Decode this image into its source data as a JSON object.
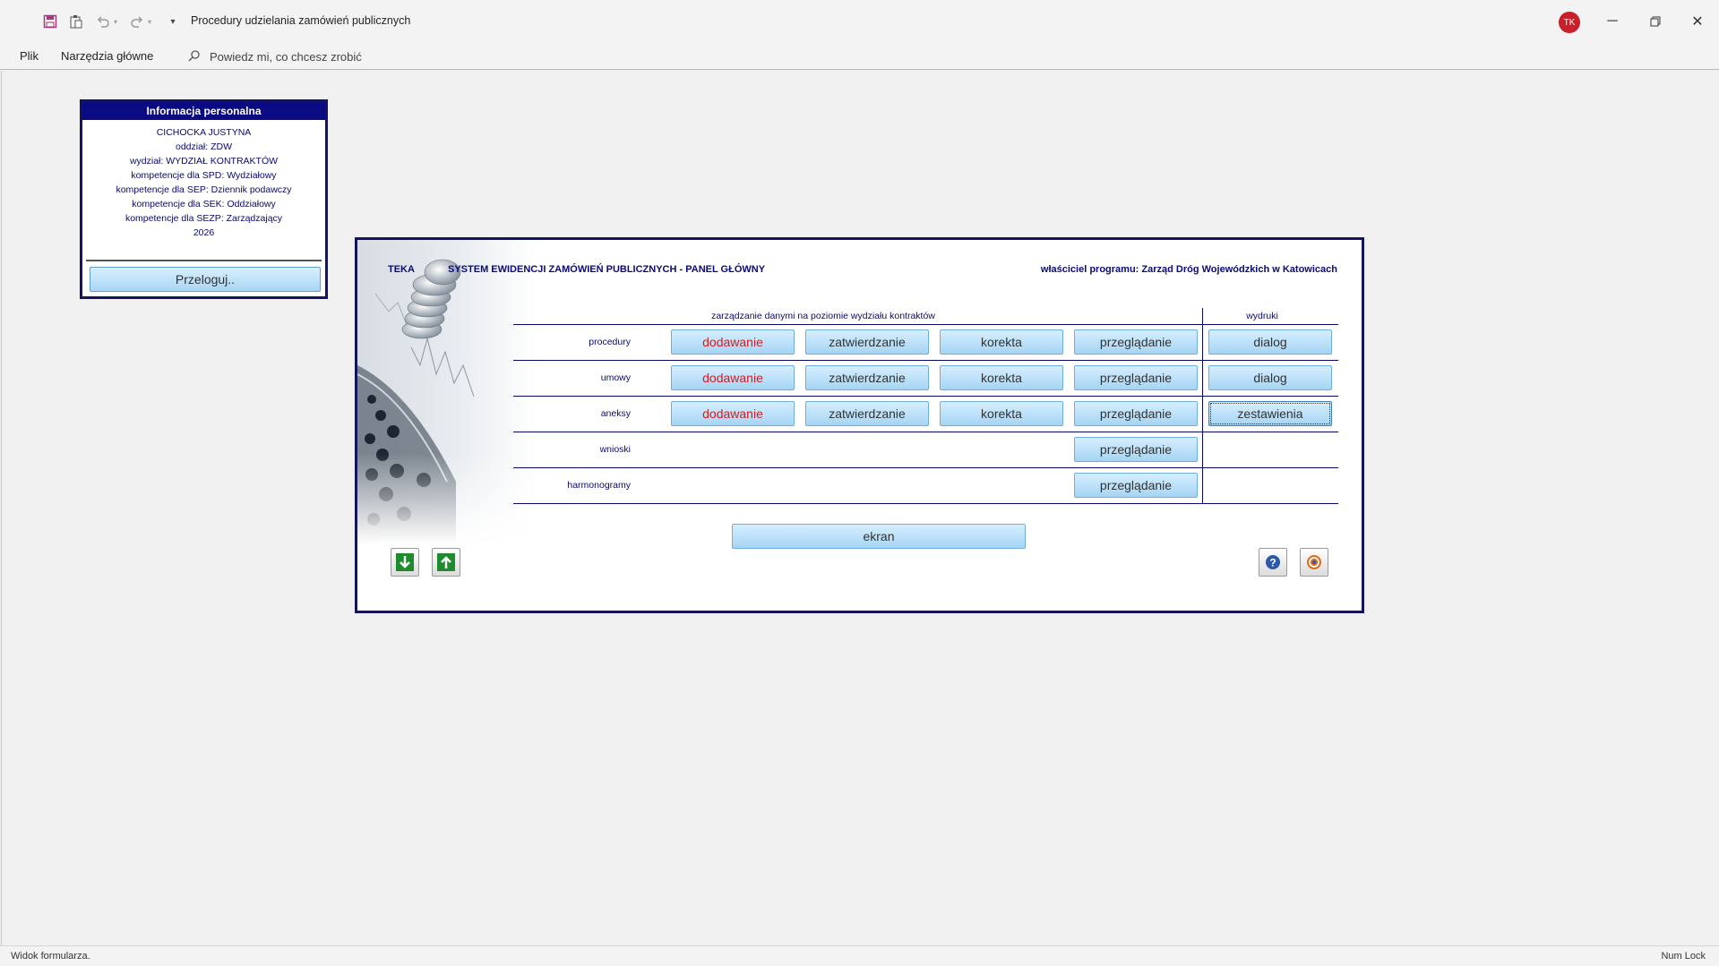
{
  "window": {
    "title": "Procedury udzielania zamówień publicznych",
    "user_initials": "TK"
  },
  "menu": {
    "file": "Plik",
    "home": "Narzędzia główne",
    "tell_me": "Powiedz mi, co chcesz zrobić"
  },
  "info_panel": {
    "title": "Informacja personalna",
    "lines": [
      "CICHOCKA JUSTYNA",
      "oddział: ZDW",
      "wydział: WYDZIAŁ KONTRAKTÓW",
      "kompetencje dla SPD: Wydziałowy",
      "kompetencje dla SEP: Dziennik podawczy",
      "kompetencje dla SEK: Oddziałowy",
      "kompetencje dla SEZP: Zarządzający",
      "2026"
    ],
    "logout_label": "Przeloguj.."
  },
  "main_panel": {
    "app_name": "TEKA",
    "system_title": "SYSTEM EWIDENCJI ZAMÓWIEŃ PUBLICZNYCH - PANEL GŁÓWNY",
    "owner": "właściciel programu: Zarząd Dróg Wojewódzkich w Katowicach",
    "header_management": "zarządzanie danymi na poziomie wydziału kontraktów",
    "header_printouts": "wydruki",
    "rows": [
      {
        "label": "procedury",
        "add": "dodawanie",
        "approve": "zatwierdzanie",
        "correct": "korekta",
        "browse": "przeglądanie",
        "print": "dialog"
      },
      {
        "label": "umowy",
        "add": "dodawanie",
        "approve": "zatwierdzanie",
        "correct": "korekta",
        "browse": "przeglądanie",
        "print": "dialog"
      },
      {
        "label": "aneksy",
        "add": "dodawanie",
        "approve": "zatwierdzanie",
        "correct": "korekta",
        "browse": "przeglądanie",
        "print": "zestawienia"
      },
      {
        "label": "wnioski",
        "browse": "przeglądanie"
      },
      {
        "label": "harmonogramy",
        "browse": "przeglądanie"
      }
    ],
    "screen_button": "ekran"
  },
  "status": {
    "text": "Widok formularza.",
    "numlock": "Num Lock"
  },
  "colors": {
    "accent_red": "#d71921",
    "panel_border": "#14145e",
    "info_header": "#0a0a82",
    "button_blue": "#a6d4f4"
  }
}
